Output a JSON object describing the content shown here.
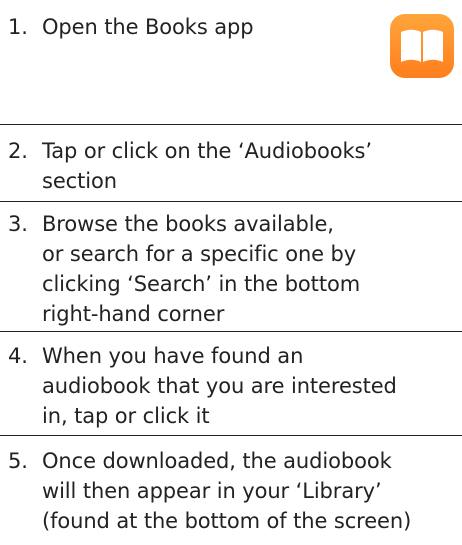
{
  "steps": [
    {
      "number": "1.",
      "text": "Open the Books app"
    },
    {
      "number": "2.",
      "text": "Tap or click on the ‘Audiobooks’\nsection"
    },
    {
      "number": "3.",
      "text": "Browse the books available,\nor search for a specific one by\nclicking ‘Search’ in the bottom\nright-hand corner"
    },
    {
      "number": "4.",
      "text": "When you have found an\naudiobook that you are interested\nin, tap or click it"
    },
    {
      "number": "5.",
      "text": "Once downloaded, the audiobook\nwill then appear in your ‘Library’\n(found at the bottom of the screen)"
    }
  ],
  "colors": {
    "text": "#222222",
    "divider": "#222222",
    "books_icon_top": "#ffa53a",
    "books_icon_bottom": "#ff7e1d"
  },
  "icons": {
    "books_app": "books-app-icon"
  }
}
